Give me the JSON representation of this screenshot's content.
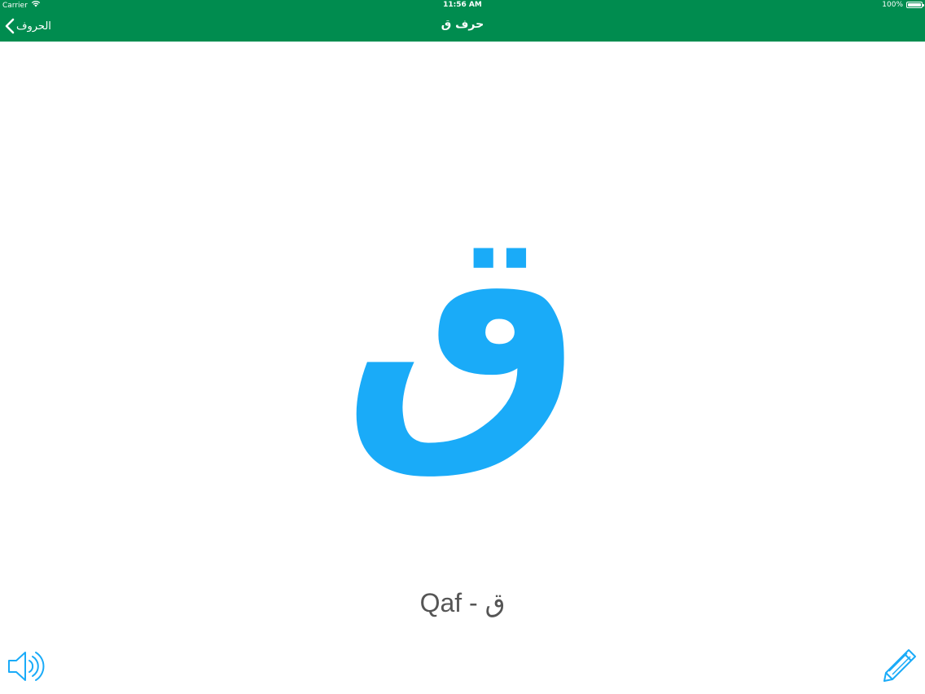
{
  "status_bar": {
    "carrier": "Carrier",
    "time": "11:56 AM",
    "battery": "100%"
  },
  "nav": {
    "back_label": "الحروف",
    "title": "حرف ق"
  },
  "letter": {
    "glyph": "ق",
    "caption": "Qaf - ق"
  },
  "colors": {
    "nav_background": "#008c4f",
    "letter": "#1aabf8",
    "caption": "#555555",
    "icons": "#1aabf8"
  },
  "icons": {
    "back": "chevron-left-icon",
    "sound": "speaker-icon",
    "edit": "pencil-icon",
    "wifi": "wifi-icon",
    "battery": "battery-icon"
  }
}
